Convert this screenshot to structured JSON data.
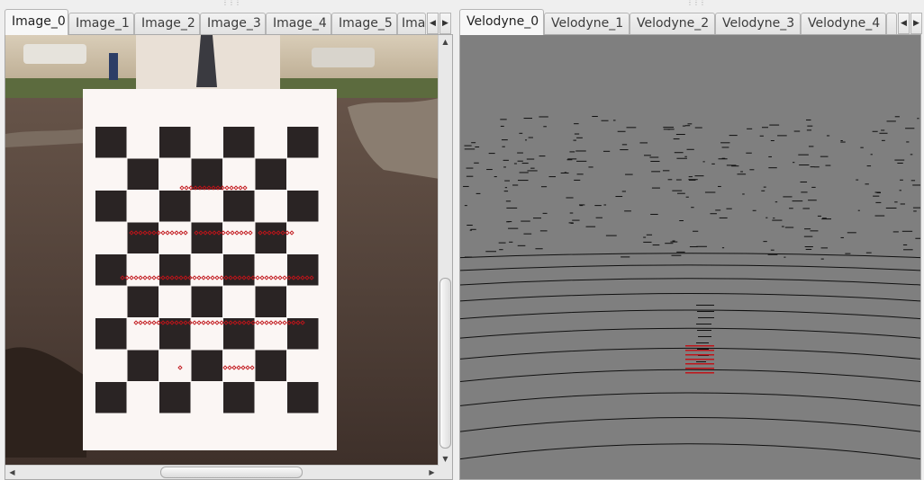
{
  "left_panel": {
    "tabs": [
      {
        "label": "Image_0",
        "active": true
      },
      {
        "label": "Image_1",
        "active": false
      },
      {
        "label": "Image_2",
        "active": false
      },
      {
        "label": "Image_3",
        "active": false
      },
      {
        "label": "Image_4",
        "active": false
      },
      {
        "label": "Image_5",
        "active": false
      },
      {
        "label": "Imag",
        "active": false
      }
    ],
    "scroll_left_icon": "◀",
    "scroll_right_icon": "▶"
  },
  "right_panel": {
    "tabs": [
      {
        "label": "Velodyne_0",
        "active": true
      },
      {
        "label": "Velodyne_1",
        "active": false
      },
      {
        "label": "Velodyne_2",
        "active": false
      },
      {
        "label": "Velodyne_3",
        "active": false
      },
      {
        "label": "Velodyne_4",
        "active": false
      }
    ],
    "scroll_left_icon": "◀",
    "scroll_right_icon": "▶"
  },
  "scrollbars": {
    "up": "▲",
    "down": "▼",
    "left": "◀",
    "right": "▶"
  },
  "colors": {
    "checker_dark": "#2a2424",
    "board": "#fbf6f4",
    "marker": "#c0141a",
    "cloud_bg": "#7f7f7f",
    "cloud_points": "#101010"
  }
}
